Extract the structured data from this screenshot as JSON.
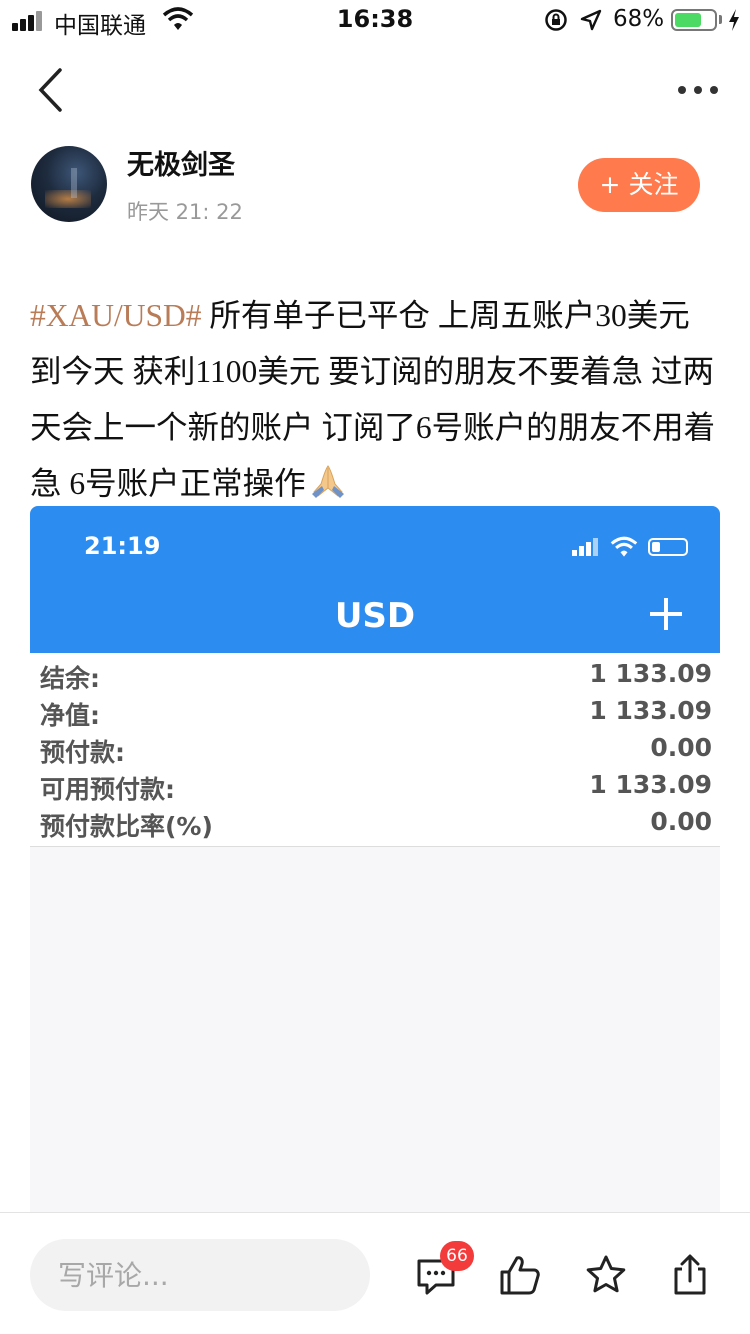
{
  "status_bar": {
    "carrier": "中国联通",
    "time": "16:38",
    "battery_percent": "68%",
    "battery_level": 0.68,
    "icons": [
      "signal-icon",
      "wifi-icon",
      "rotation-lock-icon",
      "location-icon",
      "battery-icon",
      "charging-icon"
    ]
  },
  "nav": {
    "back_icon": "chevron-left-icon",
    "more_icon": "more-dots-icon"
  },
  "author": {
    "name": "无极剑圣",
    "time": "昨天 21: 22",
    "follow_label": "+ 关注"
  },
  "post": {
    "tag": "#XAU/USD#",
    "text": " 所有单子已平仓 上周五账户30美元到今天 获利1100美元 要订阅的朋友不要着急 过两天会上一个新的账户 订阅了6号账户的朋友不用着急 6号账户正常操作",
    "emoji_icon": "praying-hands-icon"
  },
  "screenshot": {
    "time": "21:19",
    "title": "USD",
    "header_color": "#2d8cf0",
    "rows": [
      {
        "label": "结余:",
        "value": "1 133.09"
      },
      {
        "label": "净值:",
        "value": "1 133.09"
      },
      {
        "label": "预付款:",
        "value": "0.00"
      },
      {
        "label": "可用预付款:",
        "value": "1 133.09"
      },
      {
        "label": "预付款比率(%)",
        "value": "0.00"
      }
    ]
  },
  "bottom_bar": {
    "comment_placeholder": "写评论...",
    "comment_count": "66",
    "icons": [
      "comment-icon",
      "like-icon",
      "star-icon",
      "share-icon"
    ]
  },
  "colors": {
    "follow": "#ff7a4d",
    "tag": "#b97c57",
    "badge": "#f43b3b"
  }
}
